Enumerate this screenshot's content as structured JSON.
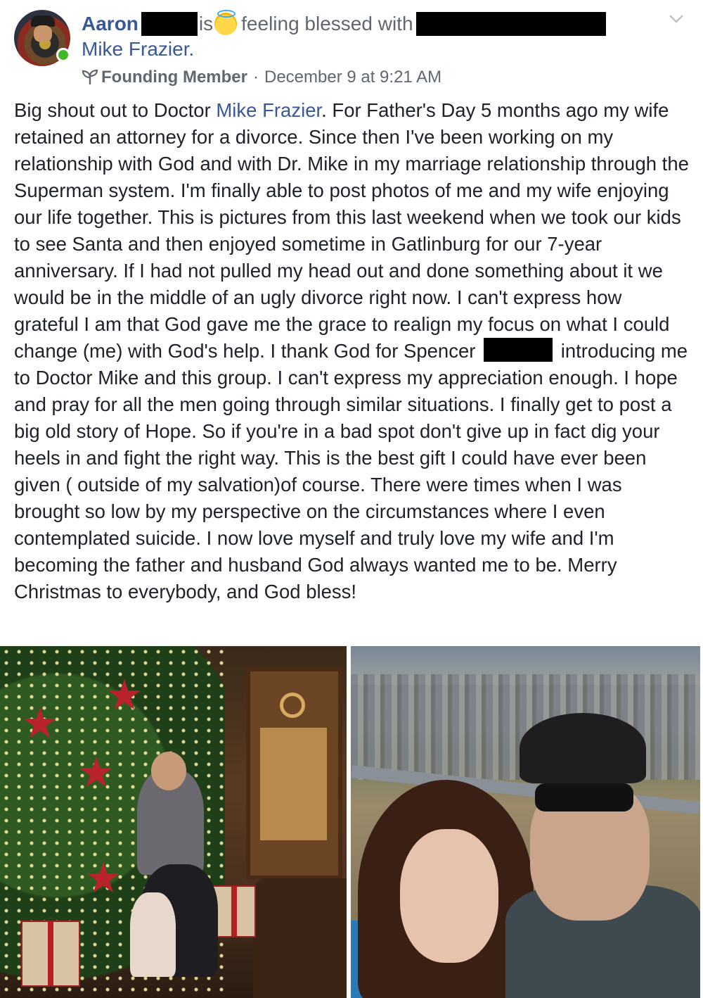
{
  "post": {
    "author_name": "Aaron",
    "is_text": "is",
    "feeling_text": "feeling blessed with",
    "tagged_name": "Mike Frazier.",
    "badge_label": "Founding Member",
    "separator": "·",
    "timestamp": "December 9 at 9:21 AM",
    "icons": {
      "feeling_emoji": "smiling-face-with-halo-icon",
      "badge": "sprout-icon",
      "menu": "chevron-down-icon"
    },
    "body": {
      "part1": "Big shout out to Doctor ",
      "mention": "Mike Frazier",
      "part2": ". For Father's Day 5 months ago my wife retained an attorney for a divorce. Since then I've been working on my relationship with God and with Dr. Mike in my marriage relationship through the Superman system. I'm finally able to post photos of me and my wife enjoying our life together. This is pictures from this last weekend when we took our kids to see Santa and then enjoyed sometime in Gatlinburg for our 7-year anniversary. If I had not pulled my head out and done something about it we would be in the middle of an ugly divorce right now. I can't express how grateful I am that God gave me the grace to realign my focus on what I could change (me) with God's help. I thank God for Spencer",
      "part3": "introducing me to Doctor Mike and this group. I can't express my appreciation enough. I hope and pray for all the men going through similar situations. I finally get to post a big old story of Hope. So if you're in a bad spot don't give up in fact dig your heels in and fight the right way. This is the best gift I could have ever been given ( outside of my salvation)of course. There were times when I was brought so low by my perspective on the circumstances where I even contemplated suicide. I now love myself and truly love my wife and I'm becoming the father and husband God always wanted me to be. Merry Christmas to everybody, and God bless!"
    },
    "colors": {
      "link": "#385898",
      "online": "#42b72a",
      "text": "#1d2129",
      "meta": "#606770"
    }
  }
}
